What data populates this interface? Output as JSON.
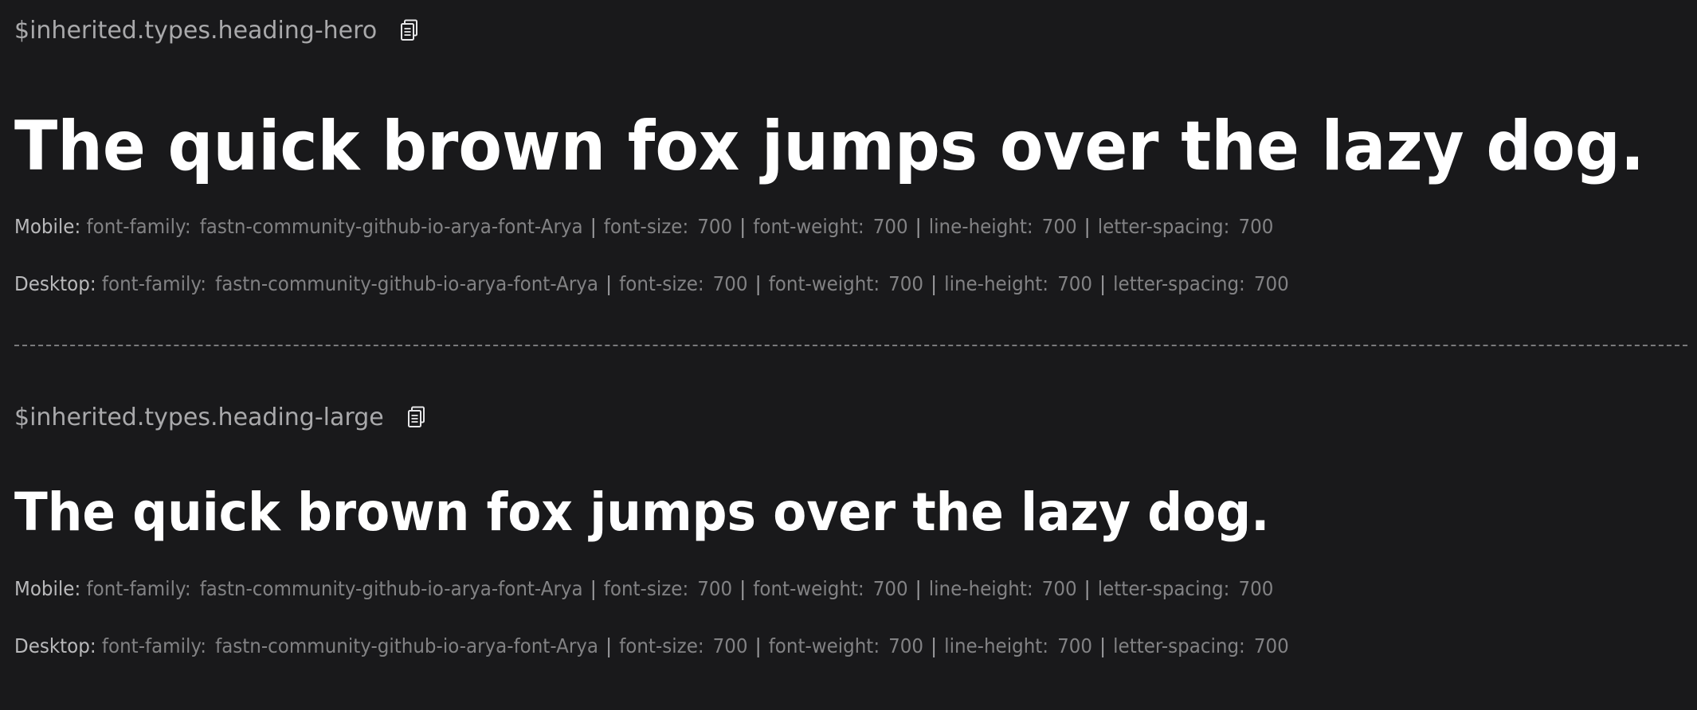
{
  "sections": [
    {
      "type_name": "$inherited.types.heading-hero",
      "copy_icon": "copy-icon",
      "sample_text": "The quick brown fox jumps over the lazy dog.",
      "mobile": {
        "label": "Mobile:",
        "font_family_label": "font-family:",
        "font_family_value": "fastn-community-github-io-arya-font-Arya",
        "font_size_label": "font-size:",
        "font_size_value": "700",
        "font_weight_label": "font-weight:",
        "font_weight_value": "700",
        "line_height_label": "line-height:",
        "line_height_value": "700",
        "letter_spacing_label": "letter-spacing:",
        "letter_spacing_value": "700"
      },
      "desktop": {
        "label": "Desktop:",
        "font_family_label": "font-family:",
        "font_family_value": "fastn-community-github-io-arya-font-Arya",
        "font_size_label": "font-size:",
        "font_size_value": "700",
        "font_weight_label": "font-weight:",
        "font_weight_value": "700",
        "line_height_label": "line-height:",
        "line_height_value": "700",
        "letter_spacing_label": "letter-spacing:",
        "letter_spacing_value": "700"
      }
    },
    {
      "type_name": "$inherited.types.heading-large",
      "copy_icon": "copy-icon",
      "sample_text": "The quick brown fox jumps over the lazy dog.",
      "mobile": {
        "label": "Mobile:",
        "font_family_label": "font-family:",
        "font_family_value": "fastn-community-github-io-arya-font-Arya",
        "font_size_label": "font-size:",
        "font_size_value": "700",
        "font_weight_label": "font-weight:",
        "font_weight_value": "700",
        "line_height_label": "line-height:",
        "line_height_value": "700",
        "letter_spacing_label": "letter-spacing:",
        "letter_spacing_value": "700"
      },
      "desktop": {
        "label": "Desktop:",
        "font_family_label": "font-family:",
        "font_family_value": "fastn-community-github-io-arya-font-Arya",
        "font_size_label": "font-size:",
        "font_size_value": "700",
        "font_weight_label": "font-weight:",
        "font_weight_value": "700",
        "line_height_label": "line-height:",
        "line_height_value": "700",
        "letter_spacing_label": "letter-spacing:",
        "letter_spacing_value": "700"
      }
    }
  ],
  "separator": "|",
  "colors": {
    "background": "#19191b",
    "sample_text": "#ffffff",
    "type_name": "#a9a9ab",
    "spec_value": "#828284",
    "divider": "#7a7a7c"
  }
}
